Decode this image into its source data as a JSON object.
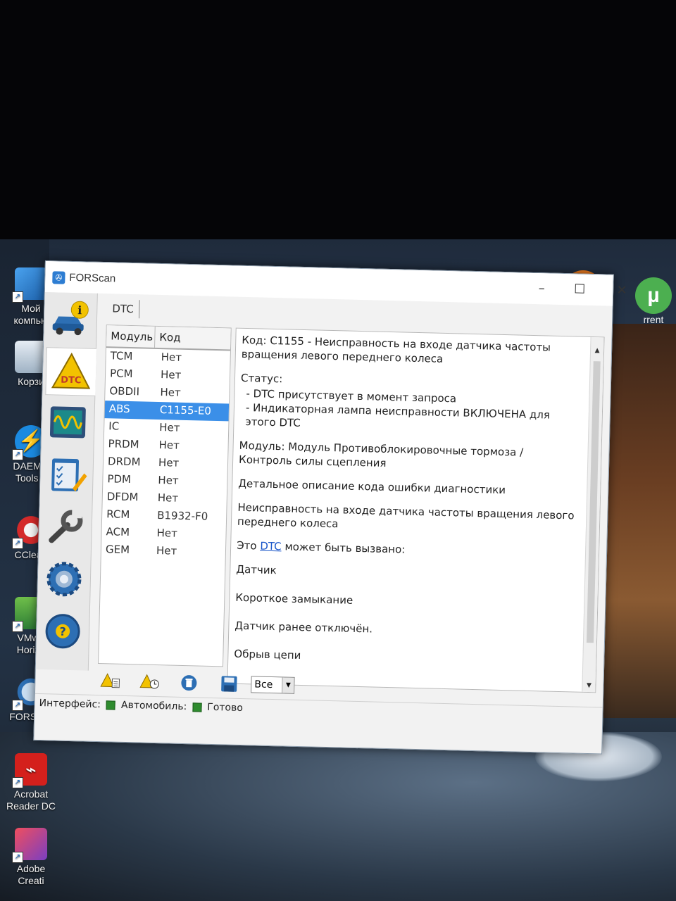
{
  "desktop": {
    "icons": [
      {
        "label": "Мой\nкомпью"
      },
      {
        "label": "Корзи"
      },
      {
        "label": "DAEMO\nTools L"
      },
      {
        "label": "CClean"
      },
      {
        "label": "VMwa\nHorizo"
      },
      {
        "label": "FORScan"
      },
      {
        "label": "Acrobat\nReader DC"
      },
      {
        "label": "Adobe\nCreati"
      }
    ],
    "right_icon_label": "rrent"
  },
  "window": {
    "title": "FORScan",
    "controls": {
      "minimize": "–",
      "maximize": "☐",
      "close": "✕"
    }
  },
  "sidenav": {
    "items": [
      {
        "icon": "car-info-icon"
      },
      {
        "icon": "dtc-warning-icon",
        "label": "DTC",
        "active": true
      },
      {
        "icon": "oscilloscope-icon"
      },
      {
        "icon": "checklist-icon"
      },
      {
        "icon": "wrench-icon"
      },
      {
        "icon": "settings-gear-icon"
      },
      {
        "icon": "help-wheel-icon"
      }
    ]
  },
  "tab": {
    "label": "DTC"
  },
  "module_list": {
    "headers": [
      "Модуль",
      "Код"
    ],
    "rows": [
      {
        "module": "TCM",
        "code": "Нет"
      },
      {
        "module": "PCM",
        "code": "Нет"
      },
      {
        "module": "OBDII",
        "code": "Нет"
      },
      {
        "module": "ABS",
        "code": "C1155-E0",
        "selected": true
      },
      {
        "module": "IC",
        "code": "Нет"
      },
      {
        "module": "PRDM",
        "code": "Нет"
      },
      {
        "module": "DRDM",
        "code": "Нет"
      },
      {
        "module": "PDM",
        "code": "Нет"
      },
      {
        "module": "DFDM",
        "code": "Нет"
      },
      {
        "module": "RCM",
        "code": "B1932-F0"
      },
      {
        "module": "ACM",
        "code": "Нет"
      },
      {
        "module": "GEM",
        "code": "Нет"
      }
    ]
  },
  "detail": {
    "code_line": "Код: C1155 - Неисправность на входе датчика частоты вращения левого переднего колеса",
    "status_title": "Статус:",
    "status_1": "- DTC присутствует в момент запроса",
    "status_2": "- Индикаторная лампа неисправности ВКЛЮЧЕНА для этого DTC",
    "module_line": "Модуль: Модуль Противоблокировочные тормоза / Контроль силы сцепления",
    "desc_title": "Детальное описание кода ошибки диагностики",
    "desc_text": "Неисправность на входе датчика частоты вращения левого переднего колеса",
    "cause_prefix": "Это",
    "cause_link": "DTC",
    "cause_suffix": "может быть вызвано:",
    "causes": [
      "Датчик",
      "Короткое замыкание",
      "Датчик ранее отключён.",
      "Обрыв цепи"
    ]
  },
  "toolbar": {
    "filter_value": "Все"
  },
  "statusbar": {
    "interface_label": "Интерфейс:",
    "vehicle_label": "Автомобиль:",
    "ready_label": "Готово",
    "led_color": "#2e8b2e"
  }
}
